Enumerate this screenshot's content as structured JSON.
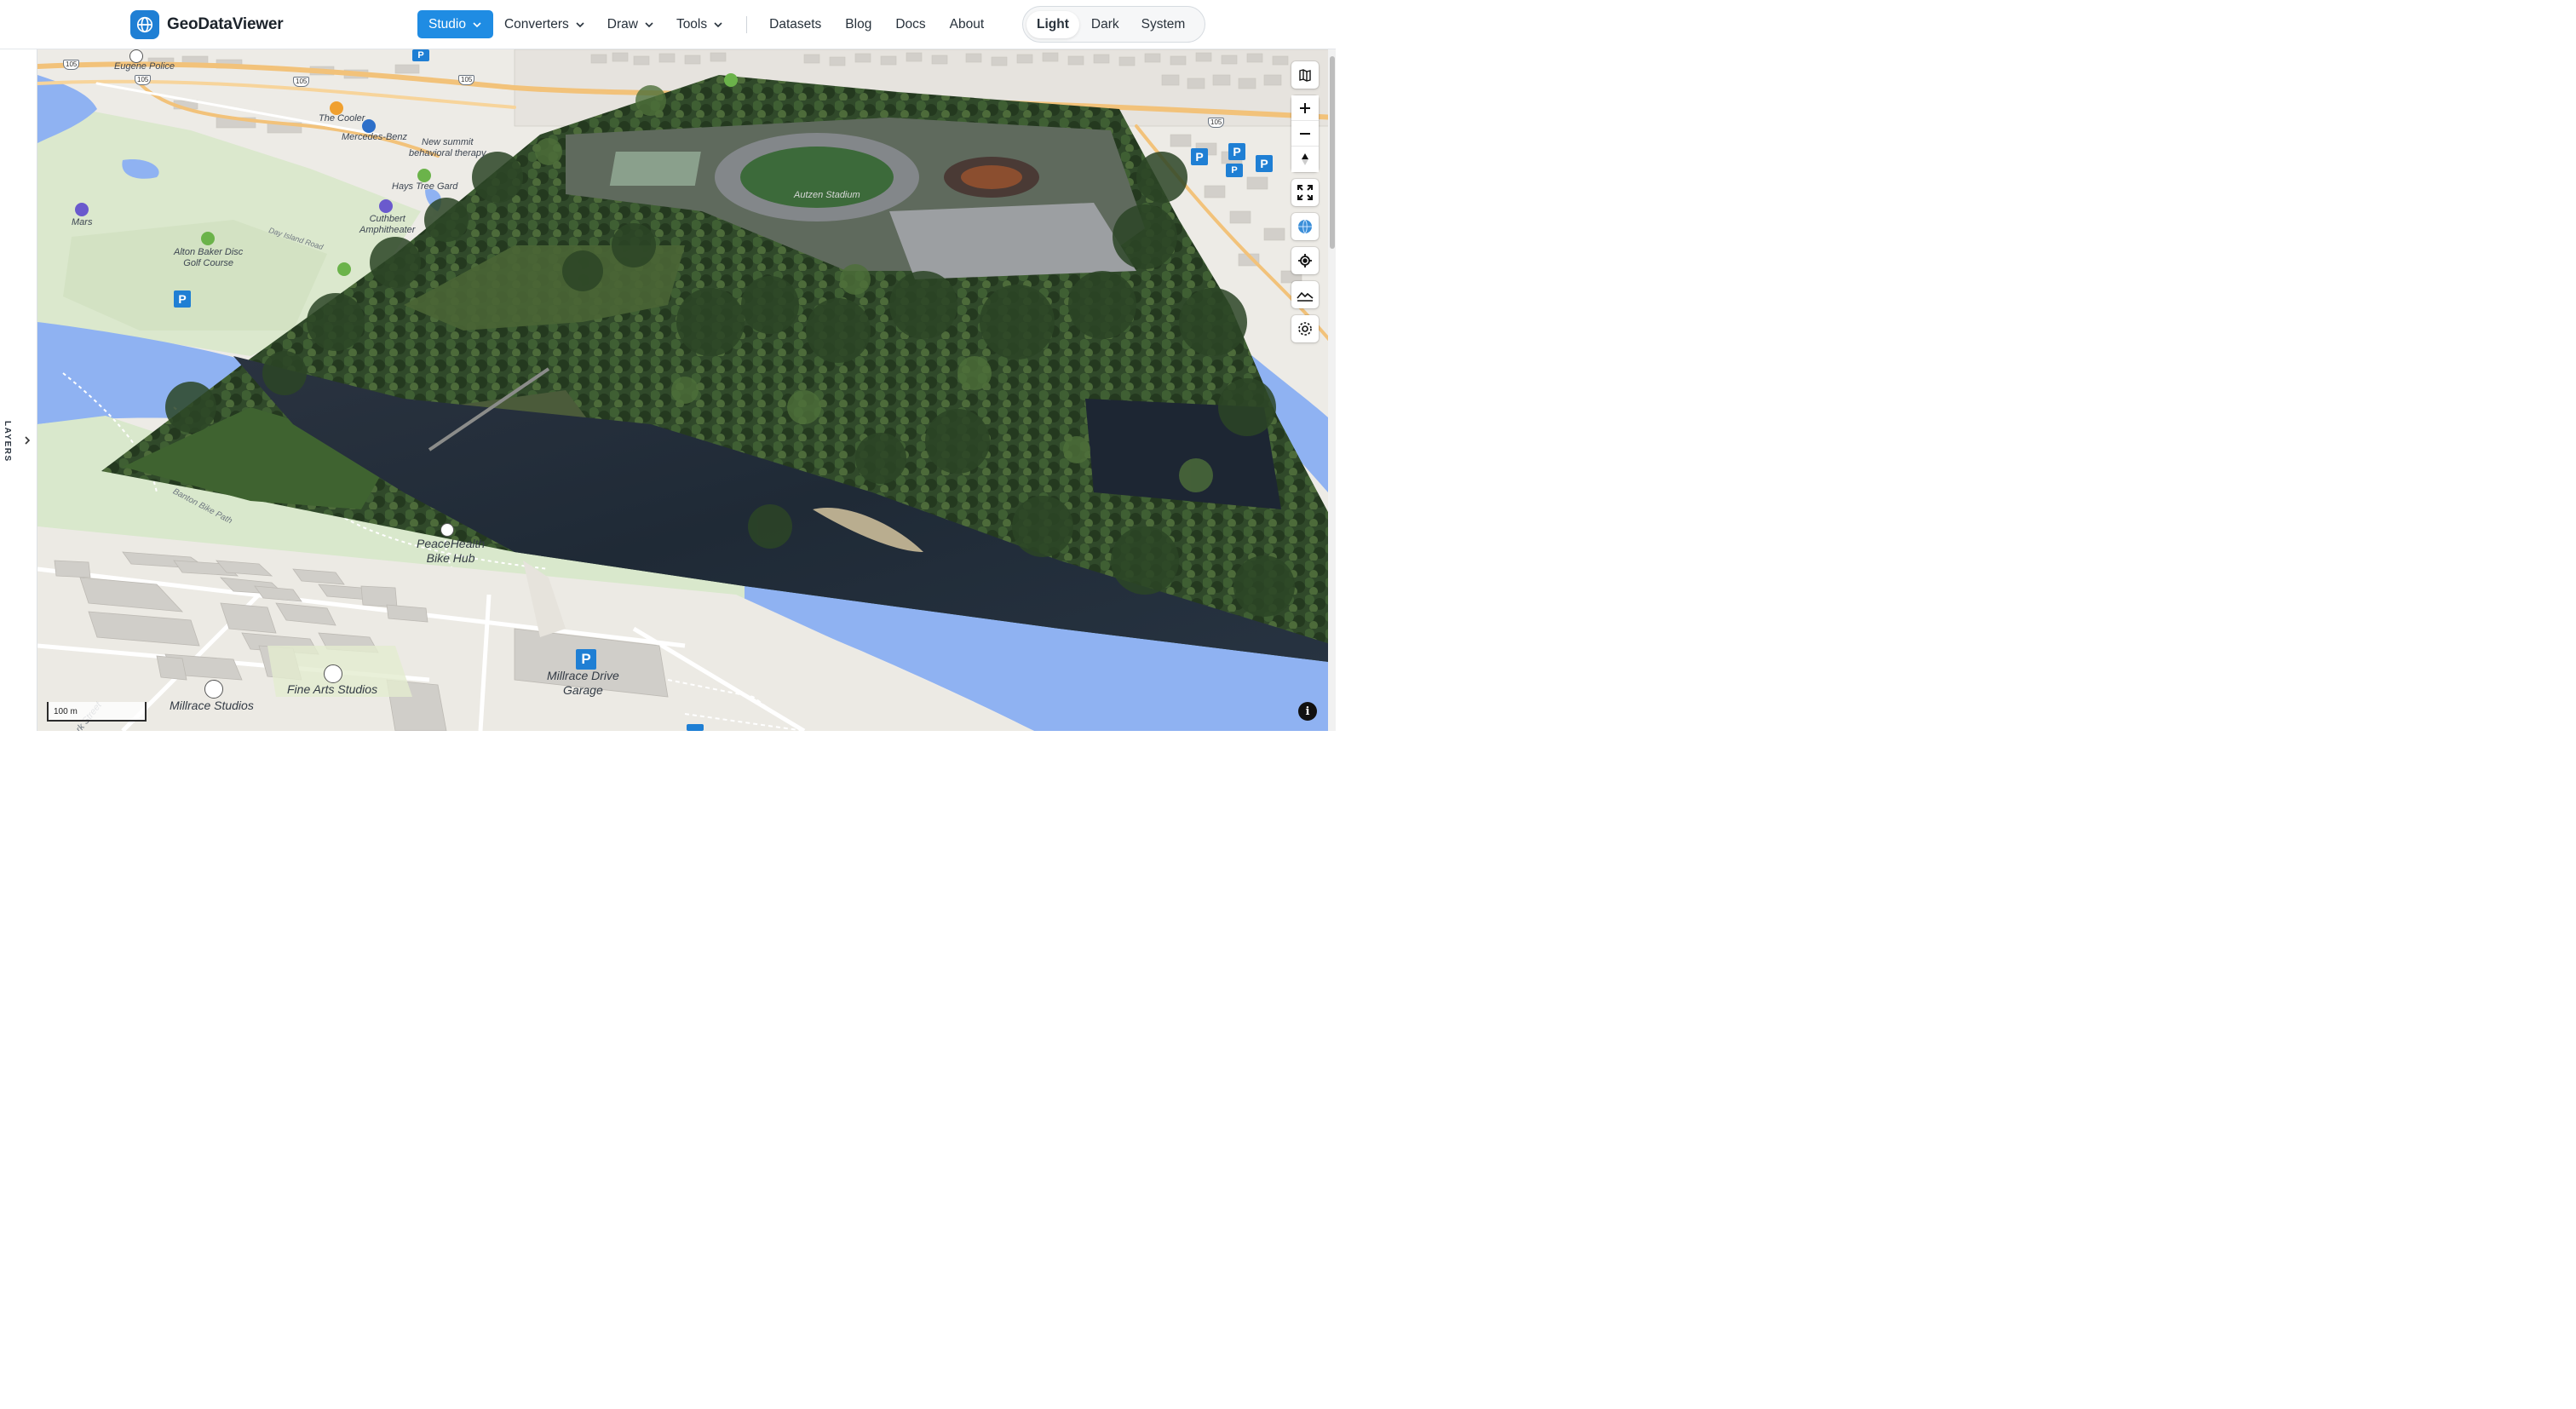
{
  "header": {
    "brand": "GeoDataViewer",
    "nav": [
      {
        "label": "Studio",
        "dropdown": true,
        "active": true
      },
      {
        "label": "Converters",
        "dropdown": true
      },
      {
        "label": "Draw",
        "dropdown": true
      },
      {
        "label": "Tools",
        "dropdown": true
      }
    ],
    "links": [
      "Datasets",
      "Blog",
      "Docs",
      "About"
    ],
    "theme": {
      "options": [
        "Light",
        "Dark",
        "System"
      ],
      "selected": "Light"
    }
  },
  "layers_panel": {
    "label": "LAYERS",
    "collapsed": true
  },
  "map": {
    "labels": {
      "eugene_police": "Eugene Police",
      "the_cooler": "The Cooler",
      "mercedes_benz": "Mercedes-Benz",
      "new_summit": "New summit\nbehavioral therapy",
      "hays_tree": "Hays Tree Gard",
      "cuthbert": "Cuthbert\nAmphitheater",
      "mars": "Mars",
      "alton_baker": "Alton Baker Disc\nGolf Course",
      "day_island_road": "Day Island Road",
      "autzen_stadium": "Autzen Stadium",
      "bike_path": "Banton Bike Path",
      "peacehealth": "PeaceHealth\nBike Hub",
      "millrace_garage": "Millrace Drive\nGarage",
      "fine_arts": "Fine Arts Studios",
      "millrace_studios": "Millrace Studios",
      "frank_street": "rk Street"
    },
    "highway_shields": [
      "105",
      "105",
      "105",
      "105",
      "105"
    ],
    "scale": "100 m",
    "controls": [
      "map-style",
      "zoom-in",
      "zoom-out",
      "compass",
      "fullscreen",
      "globe",
      "geolocate",
      "terrain",
      "settings"
    ],
    "colors": {
      "water": "#8fb2f2",
      "park": "#d9e8cc",
      "land": "#eceae4",
      "building": "#d4d2ce",
      "road_major": "#f2c27a",
      "accent": "#1f8ce3"
    }
  }
}
